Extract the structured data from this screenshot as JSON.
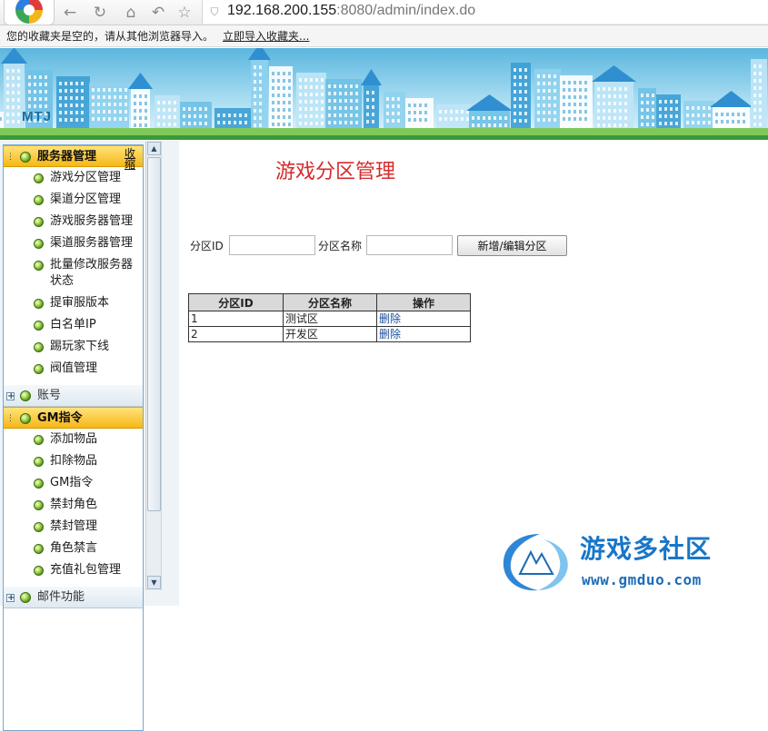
{
  "browser": {
    "url_host": "192.168.200.155",
    "url_rest": ":8080/admin/index.do",
    "bookmarks_message": "您的收藏夹是空的，请从其他浏览器导入。",
    "bookmarks_import_link": "立即导入收藏夹..."
  },
  "banner": {
    "logo": "MTJ"
  },
  "sidebar": {
    "groups": [
      {
        "title": "服务器管理",
        "collapse_label": "收缩",
        "expanded": true,
        "items": [
          {
            "label": "游戏分区管理"
          },
          {
            "label": "渠道分区管理"
          },
          {
            "label": "游戏服务器管理"
          },
          {
            "label": "渠道服务器管理"
          },
          {
            "label": "批量修改服务器状态"
          },
          {
            "label": "提审服版本"
          },
          {
            "label": "白名单IP"
          },
          {
            "label": "踢玩家下线"
          },
          {
            "label": "阀值管理"
          }
        ]
      },
      {
        "title": "账号",
        "expanded": false
      },
      {
        "title": "GM指令",
        "expanded": true,
        "items": [
          {
            "label": "添加物品"
          },
          {
            "label": "扣除物品"
          },
          {
            "label": "GM指令"
          },
          {
            "label": "禁封角色"
          },
          {
            "label": "禁封管理"
          },
          {
            "label": "角色禁言"
          },
          {
            "label": "充值礼包管理"
          }
        ]
      },
      {
        "title": "邮件功能",
        "expanded": false
      }
    ]
  },
  "main": {
    "title": "游戏分区管理",
    "form": {
      "zone_id_label": "分区ID",
      "zone_id_value": "",
      "zone_name_label": "分区名称",
      "zone_name_value": "",
      "submit_label": "新增/编辑分区"
    },
    "table": {
      "headers": [
        "分区ID",
        "分区名称",
        "操作"
      ],
      "rows": [
        {
          "id": "1",
          "name": "测试区",
          "action": "删除"
        },
        {
          "id": "2",
          "name": "开发区",
          "action": "删除"
        }
      ]
    }
  },
  "watermark": {
    "name": "游戏多社区",
    "url": "www.gmduo.com"
  },
  "colors": {
    "title_red": "#d42b2b",
    "menu_open": "#f7b717",
    "link_blue": "#1a4f9b"
  }
}
